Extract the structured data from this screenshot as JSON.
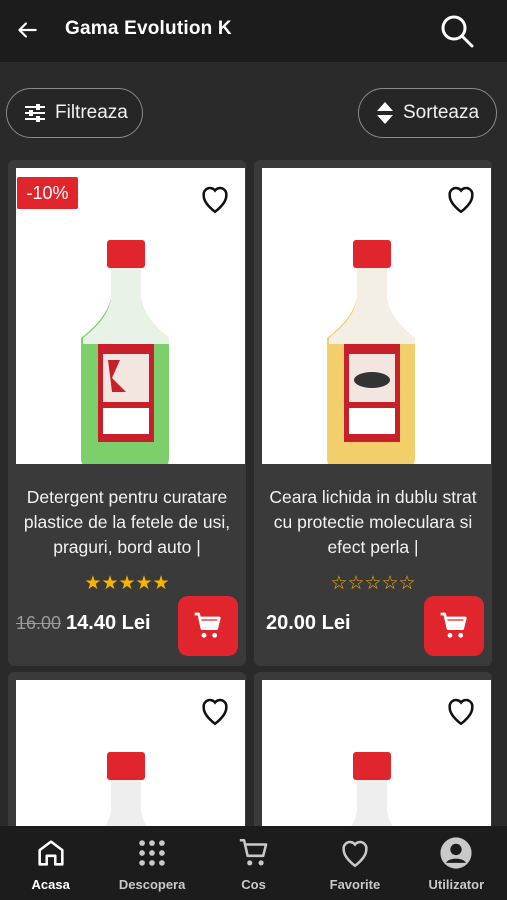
{
  "header": {
    "title": "Gama Evolution K"
  },
  "toolbar": {
    "filter_label": "Filtreaza",
    "sort_label": "Sorteaza"
  },
  "products": [
    {
      "badge": "-10%",
      "description": "Detergent pentru curatare plastice de la fetele de usi, praguri, bord auto |",
      "rating": 5,
      "old_price": "16.00",
      "price": "14.40 Lei",
      "bottle_color": "#7ccf6a"
    },
    {
      "badge": "",
      "description": "Ceara lichida in dublu strat cu protectie moleculara si efect perla |",
      "rating": 0,
      "old_price": "",
      "price": "20.00 Lei",
      "bottle_color": "#f2cf6a"
    }
  ],
  "colors": {
    "accent": "#e0262c",
    "star": "#f5b400",
    "background": "#2a2a2a",
    "card": "#3a3a3a"
  },
  "bottom_nav": [
    {
      "label": "Acasa",
      "icon": "home-icon"
    },
    {
      "label": "Descopera",
      "icon": "grid-dots-icon"
    },
    {
      "label": "Cos",
      "icon": "cart-icon"
    },
    {
      "label": "Favorite",
      "icon": "heart-icon"
    },
    {
      "label": "Utilizator",
      "icon": "user-icon"
    }
  ]
}
